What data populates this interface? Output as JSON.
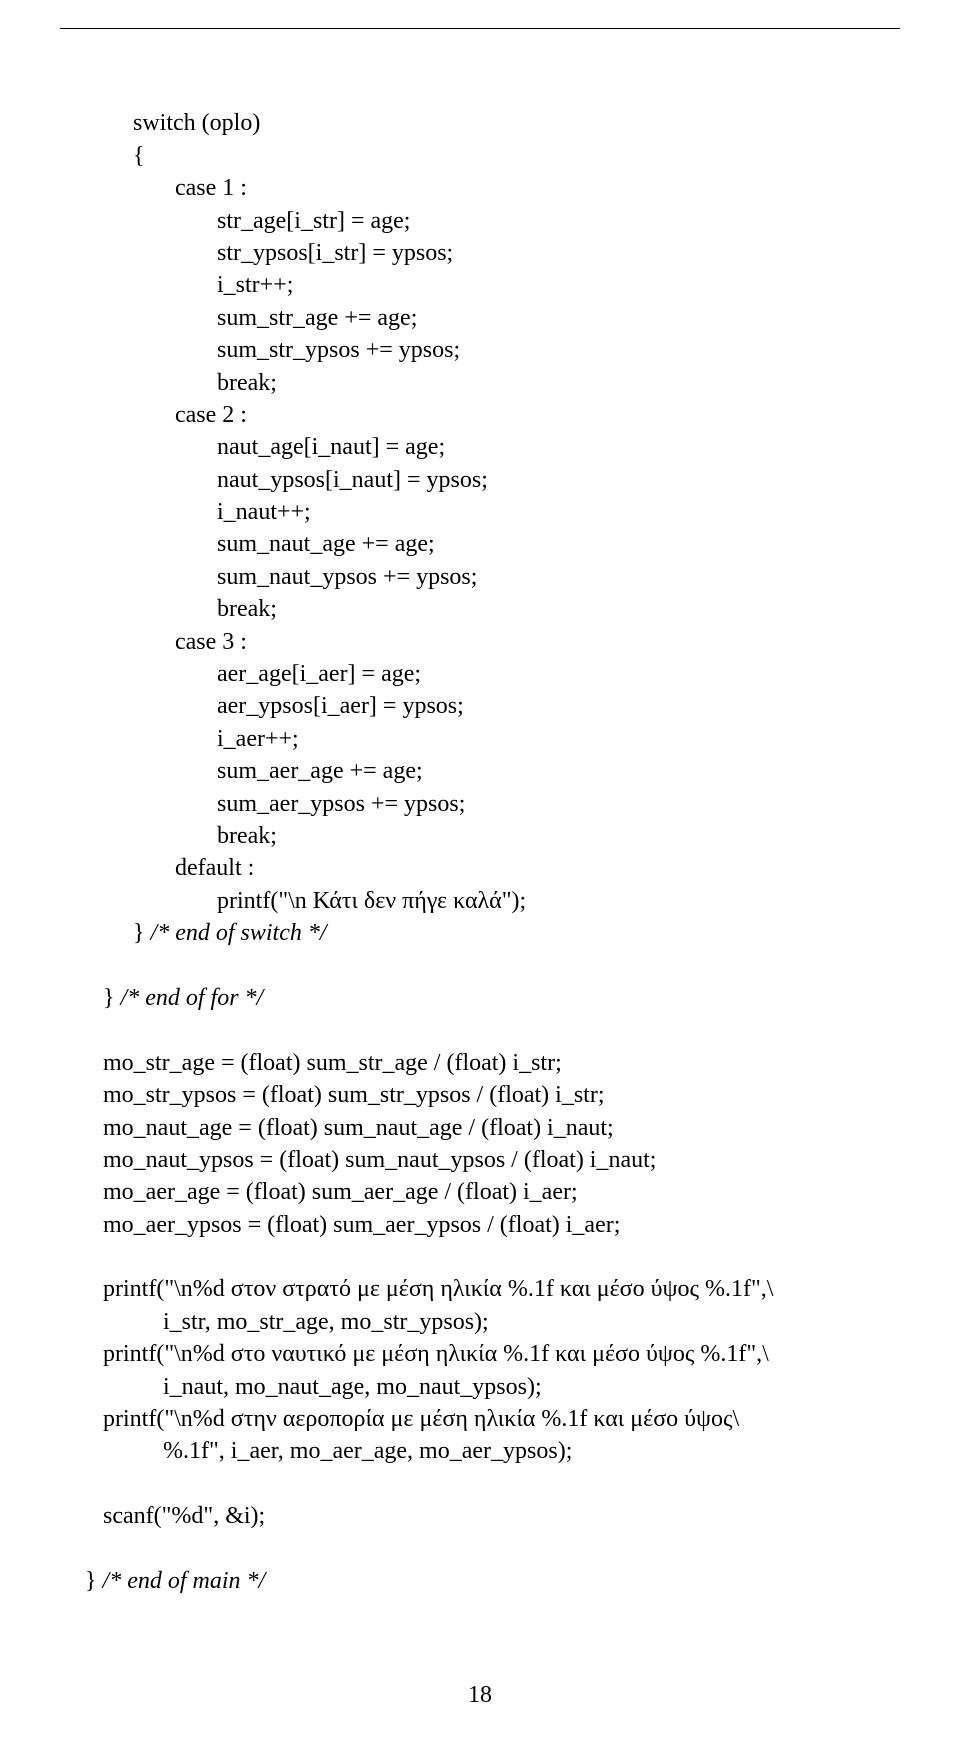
{
  "code": {
    "l1": "        switch (oplo)",
    "l2": "        {",
    "l3": "               case 1 :",
    "l4": "                      str_age[i_str] = age;",
    "l5": "                      str_ypsos[i_str] = ypsos;",
    "l6": "                      i_str++;",
    "l7": "                      sum_str_age += age;",
    "l8": "                      sum_str_ypsos += ypsos;",
    "l9": "                      break;",
    "l10": "               case 2 :",
    "l11": "                      naut_age[i_naut] = age;",
    "l12": "                      naut_ypsos[i_naut] = ypsos;",
    "l13": "                      i_naut++;",
    "l14": "                      sum_naut_age += age;",
    "l15": "                      sum_naut_ypsos += ypsos;",
    "l16": "                      break;",
    "l17": "               case 3 :",
    "l18": "                      aer_age[i_aer] = age;",
    "l19": "                      aer_ypsos[i_aer] = ypsos;",
    "l20": "                      i_aer++;",
    "l21": "                      sum_aer_age += age;",
    "l22": "                      sum_aer_ypsos += ypsos;",
    "l23": "                      break;",
    "l24": "               default :",
    "l25": "                      printf(\"\\n Κάτι δεν πήγε καλά\");",
    "l26a": "        } ",
    "l26b": "/* end of switch */",
    "l27": "",
    "l28a": "   } ",
    "l28b": "/* end of for */",
    "l29": "",
    "l30": "   mo_str_age = (float) sum_str_age / (float) i_str;",
    "l31": "   mo_str_ypsos = (float) sum_str_ypsos / (float) i_str;",
    "l32": "   mo_naut_age = (float) sum_naut_age / (float) i_naut;",
    "l33": "   mo_naut_ypsos = (float) sum_naut_ypsos / (float) i_naut;",
    "l34": "   mo_aer_age = (float) sum_aer_age / (float) i_aer;",
    "l35": "   mo_aer_ypsos = (float) sum_aer_ypsos / (float) i_aer;",
    "l36": "",
    "l37": "   printf(\"\\n%d στον στρατό με μέση ηλικία %.1f και μέσο ύψος %.1f\",\\",
    "l38": "             i_str, mo_str_age, mo_str_ypsos);",
    "l39": "   printf(\"\\n%d στο ναυτικό με μέση ηλικία %.1f και μέσο ύψος %.1f\",\\",
    "l40": "             i_naut, mo_naut_age, mo_naut_ypsos);",
    "l41": "   printf(\"\\n%d στην αεροπορία με μέση ηλικία %.1f και μέσο ύψος\\",
    "l42": "             %.1f\", i_aer, mo_aer_age, mo_aer_ypsos);",
    "l43": "",
    "l44": "   scanf(\"%d\", &i);",
    "l45": "",
    "l46a": "} ",
    "l46b": "/* end of main */"
  },
  "page_number": "18"
}
